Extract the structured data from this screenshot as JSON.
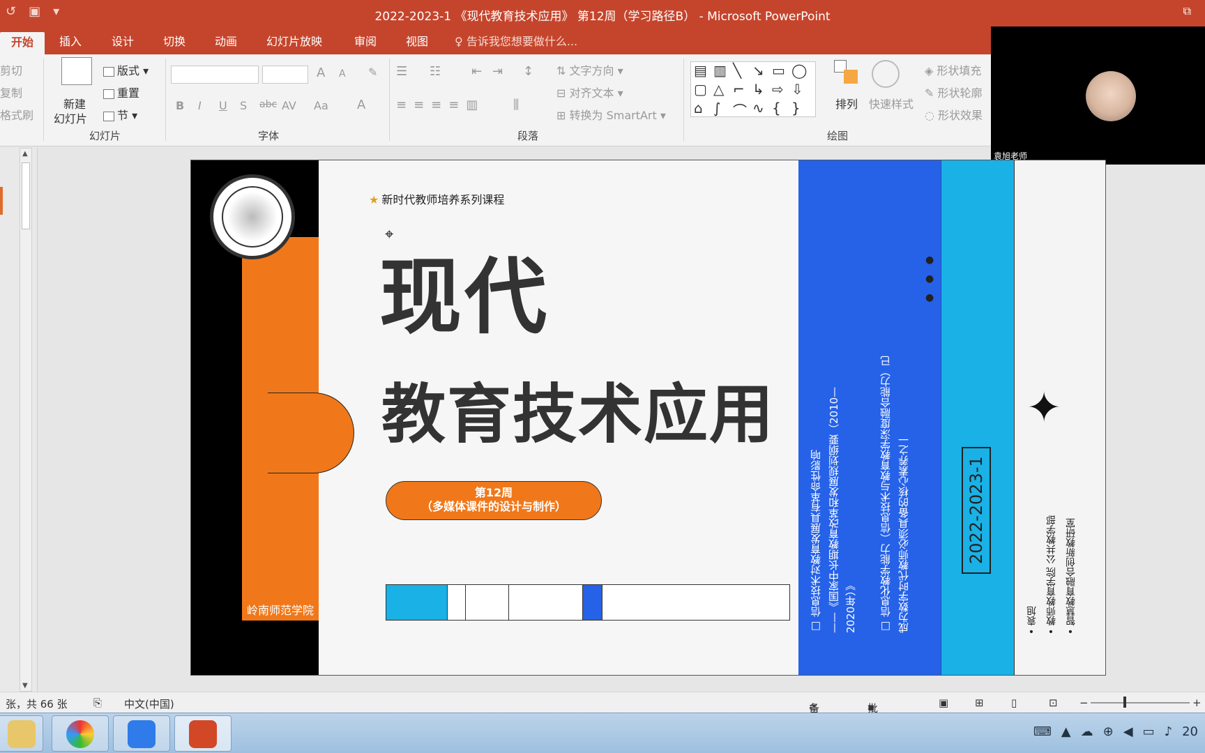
{
  "window": {
    "title": "2022-2023-1 《现代教育技术应用》 第12周（学习路径B） - Microsoft PowerPoint",
    "restore_glyph": "⧉"
  },
  "qat": {
    "undo_icon": "undo-icon",
    "slideshow_icon": "start-slideshow-icon",
    "more": "▾"
  },
  "tabs": [
    "开始",
    "插入",
    "设计",
    "切换",
    "动画",
    "幻灯片放映",
    "审阅",
    "视图"
  ],
  "tellme": "告诉我您想要做什么...",
  "ribbon": {
    "clipboard": {
      "cut": "剪切",
      "copy": "复制",
      "format_painter": "格式刷"
    },
    "slides": {
      "new_slide_line1": "新建",
      "new_slide_line2": "幻灯片",
      "layout": "版式",
      "reset": "重置",
      "section": "节",
      "label": "幻灯片"
    },
    "font": {
      "label": "字体",
      "bold": "B",
      "italic": "I",
      "underline": "U",
      "shadow": "S",
      "strike": "abc",
      "spacing": "AV",
      "case": "Aa",
      "color": "A",
      "grow": "A",
      "shrink": "A"
    },
    "paragraph": {
      "label": "段落",
      "text_direction": "文字方向",
      "align_text": "对齐文本",
      "smartart": "转换为 SmartArt"
    },
    "drawing": {
      "label": "绘图",
      "arrange": "排列",
      "quick_styles": "快速样式",
      "fill": "形状填充",
      "outline": "形状轮廓",
      "effects": "形状效果"
    }
  },
  "webcam": {
    "name": "袁旭老师"
  },
  "slide": {
    "series": "新时代教师培养系列课程",
    "title_line1": "现代",
    "title_line2": "教育技术应用",
    "week_line1": "第12周",
    "week_line2": "（多媒体课件的设计与制作）",
    "campus": "岭南师范学院",
    "blue_col1": "信息技术对教育发展具有革命性影响",
    "blue_col2": "——《国家中长期教育改革和发展规划纲要（2010—",
    "blue_col3": "2020年）》",
    "blue_col4": "信息化教学能力（信息技术与教育教学深度融合能力）已",
    "blue_col5": "成为数字时代教师必须具备的核心素养之一",
    "date": "2022-2023-1",
    "right_col1": "袁旭",
    "right_col2": "教师教育学院  公共教学部",
    "right_col3": "智慧教育融合创新教研室",
    "colors": {
      "orange": "#f0781a",
      "blue": "#2562e8",
      "cyan": "#19b1e6"
    }
  },
  "status": {
    "slide_count": "张，共 66 张",
    "language": "中文(中国)",
    "notes": "备注",
    "comments": "批注",
    "zoom_minus": "−",
    "zoom_plus": "+"
  },
  "taskbar": {
    "apps": [
      "file-explorer-icon",
      "browser-icon",
      "meeting-app-icon",
      "powerpoint-icon"
    ],
    "clock": "20"
  }
}
